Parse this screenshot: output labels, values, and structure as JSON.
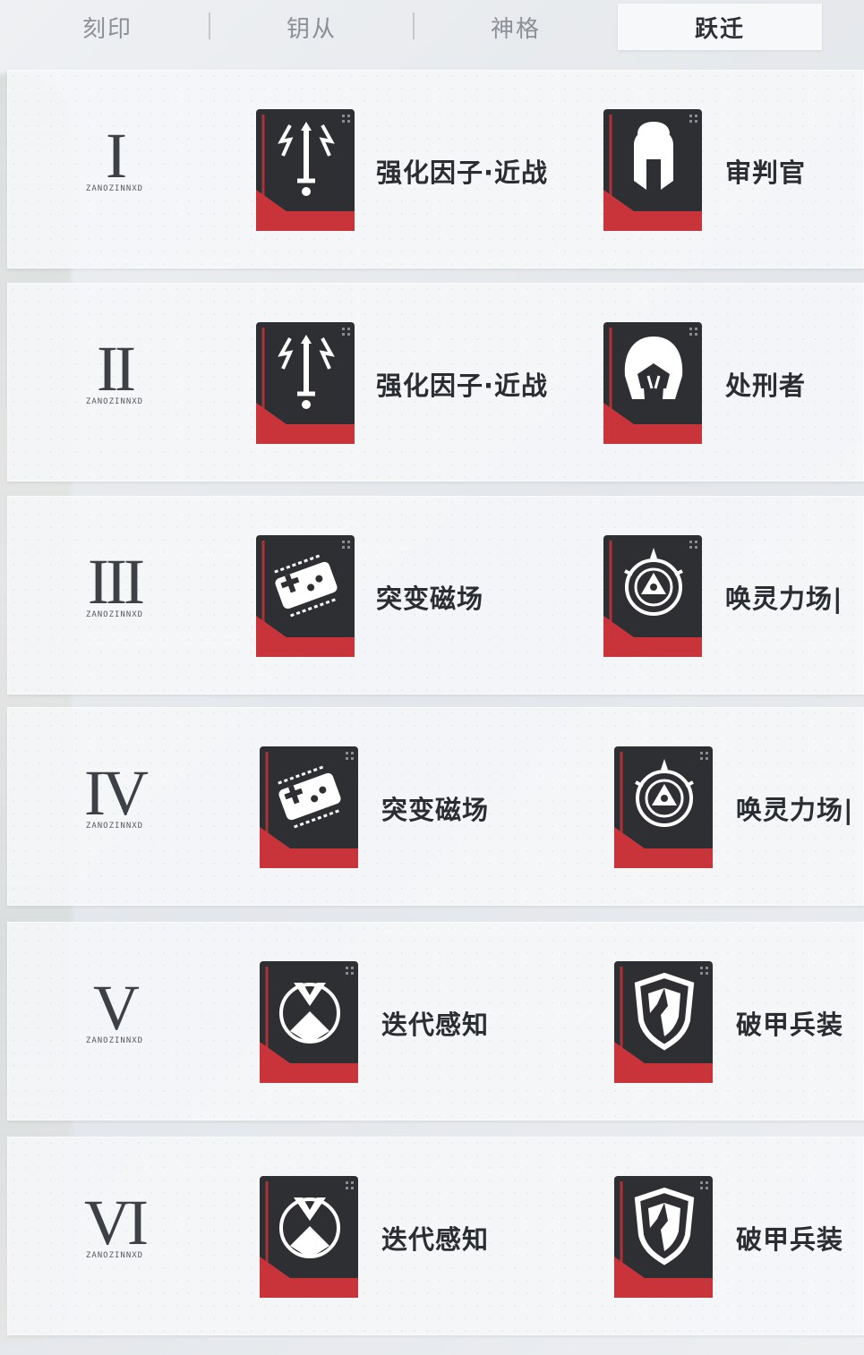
{
  "tabs": [
    {
      "label": "刻印",
      "active": false
    },
    {
      "label": "钥从",
      "active": false
    },
    {
      "label": "神格",
      "active": false
    },
    {
      "label": "跃迁",
      "active": true
    }
  ],
  "rank_subtitle": "ZANOZINNXD",
  "rows": [
    {
      "rank": "I",
      "left": {
        "icon": "sword-lightning-icon",
        "label": "强化因子·近战"
      },
      "right": {
        "icon": "spartan-helmet-icon",
        "label": "审判官"
      }
    },
    {
      "rank": "II",
      "left": {
        "icon": "sword-lightning-icon",
        "label": "强化因子·近战"
      },
      "right": {
        "icon": "hooded-helmet-icon",
        "label": "处刑者"
      }
    },
    {
      "rank": "III",
      "left": {
        "icon": "magnetic-field-icon",
        "label": "突变磁场"
      },
      "right": {
        "icon": "summon-sigil-icon",
        "label": "唤灵力场|"
      }
    },
    {
      "rank": "IV",
      "left": {
        "icon": "magnetic-field-icon",
        "label": "突变磁场"
      },
      "right": {
        "icon": "summon-sigil-icon",
        "label": "唤灵力场|"
      }
    },
    {
      "rank": "V",
      "left": {
        "icon": "iteration-icon",
        "label": "迭代感知"
      },
      "right": {
        "icon": "broken-shield-icon",
        "label": "破甲兵装"
      }
    },
    {
      "rank": "VI",
      "left": {
        "icon": "iteration-icon",
        "label": "迭代感知"
      },
      "right": {
        "icon": "broken-shield-icon",
        "label": "破甲兵装"
      }
    }
  ],
  "colors": {
    "card_dark": "#2e2f33",
    "card_red": "#c9343a",
    "accent_text": "#2a2d31"
  }
}
